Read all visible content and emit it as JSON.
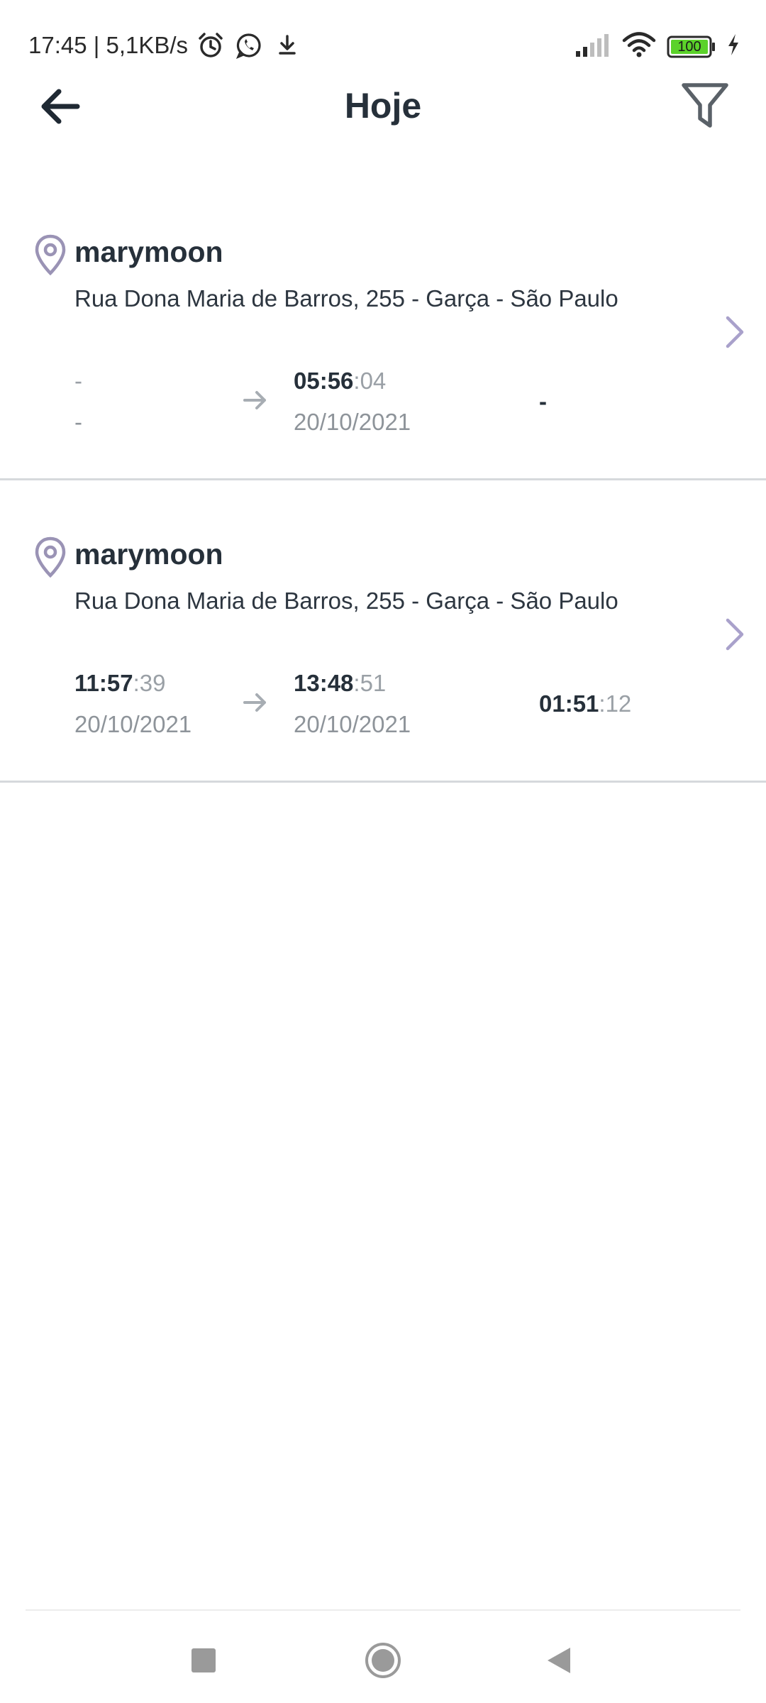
{
  "status_bar": {
    "time_speed": "17:45 | 5,1KB/s",
    "battery_level": "100",
    "icons": [
      "alarm-icon",
      "whatsapp-icon",
      "download-icon",
      "signal-icon",
      "wifi-icon",
      "battery-icon",
      "charging-icon"
    ]
  },
  "header": {
    "title": "Hoje",
    "back_icon": "arrow-left-icon",
    "filter_icon": "filter-icon"
  },
  "records": [
    {
      "name": "marymoon",
      "address": "Rua Dona Maria de Barros, 255 - Garça - São Paulo",
      "start_time": "-",
      "start_seconds": "",
      "start_date": "-",
      "end_time": "05:56",
      "end_seconds": ":04",
      "end_date": "20/10/2021",
      "duration_time": "-",
      "duration_seconds": ""
    },
    {
      "name": "marymoon",
      "address": "Rua Dona Maria de Barros, 255 - Garça - São Paulo",
      "start_time": "11:57",
      "start_seconds": ":39",
      "start_date": "20/10/2021",
      "end_time": "13:48",
      "end_seconds": ":51",
      "end_date": "20/10/2021",
      "duration_time": "01:51",
      "duration_seconds": ":12"
    }
  ],
  "colors": {
    "title_text": "#26303a",
    "muted_text": "#9aa0a6",
    "pin_icon": "#9a93b5",
    "chevron": "#a9a1cb",
    "divider": "#d6d9dc",
    "battery_fill": "#5bd22a"
  },
  "nav": {
    "icons": [
      "recent-apps-icon",
      "home-icon",
      "back-triangle-icon"
    ]
  }
}
